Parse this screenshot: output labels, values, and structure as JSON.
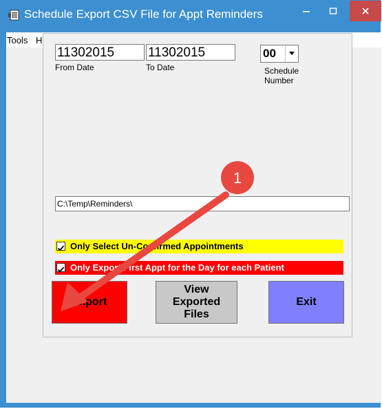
{
  "window": {
    "title": "Schedule Export CSV File for Appt Reminders",
    "icons": {
      "app": "app-icon",
      "minimize": "minimize-icon",
      "maximize": "maximize-icon",
      "close": "close-icon"
    },
    "colors": {
      "titlebar": "#3c8fd0",
      "close": "#c74a4a"
    }
  },
  "menu": {
    "items": [
      "Tools",
      "Help"
    ]
  },
  "form": {
    "from_date": {
      "value": "11302015",
      "label": "From Date"
    },
    "to_date": {
      "value": "11302015",
      "label": "To Date"
    },
    "schedule": {
      "value": "00",
      "label_line1": "Schedule",
      "label_line2": "Number"
    },
    "path": {
      "value": "C:\\Temp\\Reminders\\"
    },
    "option_unconfirmed": {
      "label": "Only Select Un-Confirmed Appointments",
      "checked": true,
      "color": "#ffff00"
    },
    "option_first_appt": {
      "label": "Only Export First Appt for the Day for each Patient",
      "checked": true,
      "color": "#ff0000"
    },
    "buttons": {
      "export": "Export",
      "view_line1": "View",
      "view_line2": "Exported",
      "view_line3": "Files",
      "exit": "Exit"
    }
  },
  "annotation": {
    "badge_number": "1",
    "color": "#e8483f"
  }
}
